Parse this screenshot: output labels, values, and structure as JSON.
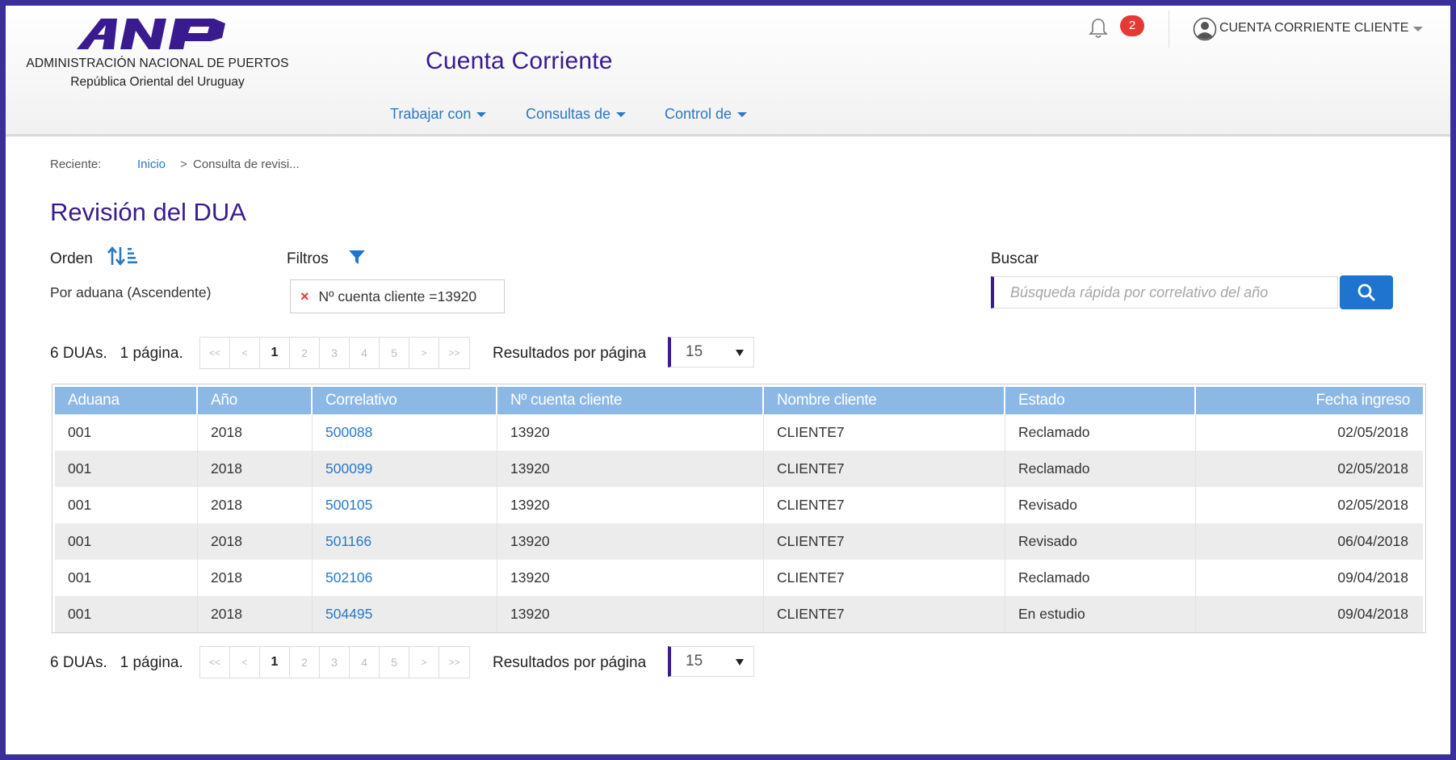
{
  "header": {
    "org_name": "ADMINISTRACIÓN NACIONAL DE PUERTOS",
    "org_country": "República Oriental del Uruguay",
    "logo_text": "ANP",
    "app_title": "Cuenta Corriente",
    "nav": [
      {
        "label": "Trabajar con"
      },
      {
        "label": "Consultas de"
      },
      {
        "label": "Control de"
      }
    ],
    "notifications_count": "2",
    "user_name": "CUENTA CORRIENTE CLIENTE"
  },
  "breadcrumb": {
    "label": "Reciente:",
    "home": "Inicio",
    "separator": ">",
    "current": "Consulta de revisi..."
  },
  "page": {
    "title": "Revisión del DUA",
    "order_label": "Orden",
    "order_value": "Por aduana (Ascendente)",
    "filters_label": "Filtros",
    "filter_chip": "Nº cuenta cliente =13920",
    "search_label": "Buscar",
    "search_placeholder": "Búsqueda rápida por correlativo del año"
  },
  "pagination": {
    "summary_count": "6 DUAs.",
    "summary_pages": "1 página.",
    "buttons": [
      "<<",
      "<",
      "1",
      "2",
      "3",
      "4",
      "5",
      ">",
      ">>"
    ],
    "active_page": "1",
    "rpp_label": "Resultados por página",
    "rpp_value": "15"
  },
  "table": {
    "columns": [
      "Aduana",
      "Año",
      "Correlativo",
      "Nº cuenta cliente",
      "Nombre cliente",
      "Estado",
      "Fecha ingreso"
    ],
    "rows": [
      [
        "001",
        "2018",
        "500088",
        "13920",
        "CLIENTE7",
        "Reclamado",
        "02/05/2018"
      ],
      [
        "001",
        "2018",
        "500099",
        "13920",
        "CLIENTE7",
        "Reclamado",
        "02/05/2018"
      ],
      [
        "001",
        "2018",
        "500105",
        "13920",
        "CLIENTE7",
        "Revisado",
        "02/05/2018"
      ],
      [
        "001",
        "2018",
        "501166",
        "13920",
        "CLIENTE7",
        "Revisado",
        "06/04/2018"
      ],
      [
        "001",
        "2018",
        "502106",
        "13920",
        "CLIENTE7",
        "Reclamado",
        "09/04/2018"
      ],
      [
        "001",
        "2018",
        "504495",
        "13920",
        "CLIENTE7",
        "En estudio",
        "09/04/2018"
      ]
    ]
  },
  "colors": {
    "brand_purple": "#3a1a8f",
    "link_blue": "#2b78c5",
    "header_blue": "#8cb8e6",
    "badge_red": "#e53935",
    "search_button": "#1f74d0"
  }
}
